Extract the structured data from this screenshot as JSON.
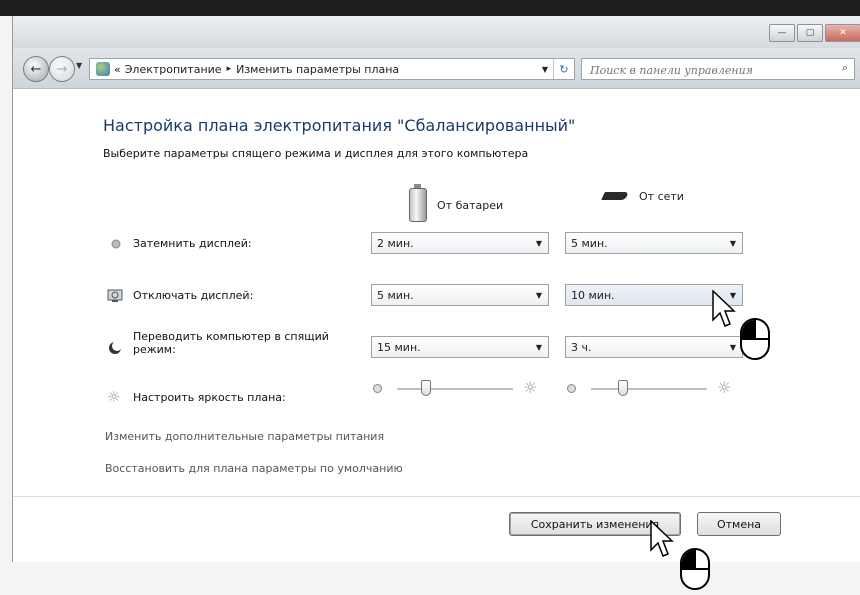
{
  "window": {
    "controls": {
      "minimize": "—",
      "maximize": "▢",
      "close": "✕"
    }
  },
  "address": {
    "back_icon": "back-arrow-icon",
    "forward_icon": "forward-arrow-icon",
    "crumb_prefix": "«",
    "crumbs": [
      "Электропитание",
      "Изменить параметры плана"
    ],
    "separator": "▸"
  },
  "search": {
    "placeholder": "Поиск в панели управления"
  },
  "page": {
    "heading": "Настройка плана электропитания \"Сбалансированный\"",
    "subheading": "Выберите параметры спящего режима и дисплея для этого компьютера"
  },
  "columns": {
    "battery": "От батареи",
    "plugged": "От сети"
  },
  "settings": [
    {
      "label": "Затемнить дисплей:",
      "battery": "2 мин.",
      "plugged": "5 мин."
    },
    {
      "label": "Отключать дисплей:",
      "battery": "5 мин.",
      "plugged": "10 мин."
    },
    {
      "label": "Переводить компьютер в спящий режим:",
      "battery": "15 мин.",
      "plugged": "3 ч."
    }
  ],
  "brightness": {
    "label": "Настроить яркость плана:",
    "battery_level": 0.25,
    "plugged_level": 0.28
  },
  "links": {
    "advanced": "Изменить дополнительные параметры питания",
    "restore": "Восстановить для плана параметры по умолчанию"
  },
  "buttons": {
    "save": "Сохранить изменения",
    "cancel": "Отмена"
  },
  "colors": {
    "heading": "#1a3a6b",
    "link": "#555555"
  }
}
